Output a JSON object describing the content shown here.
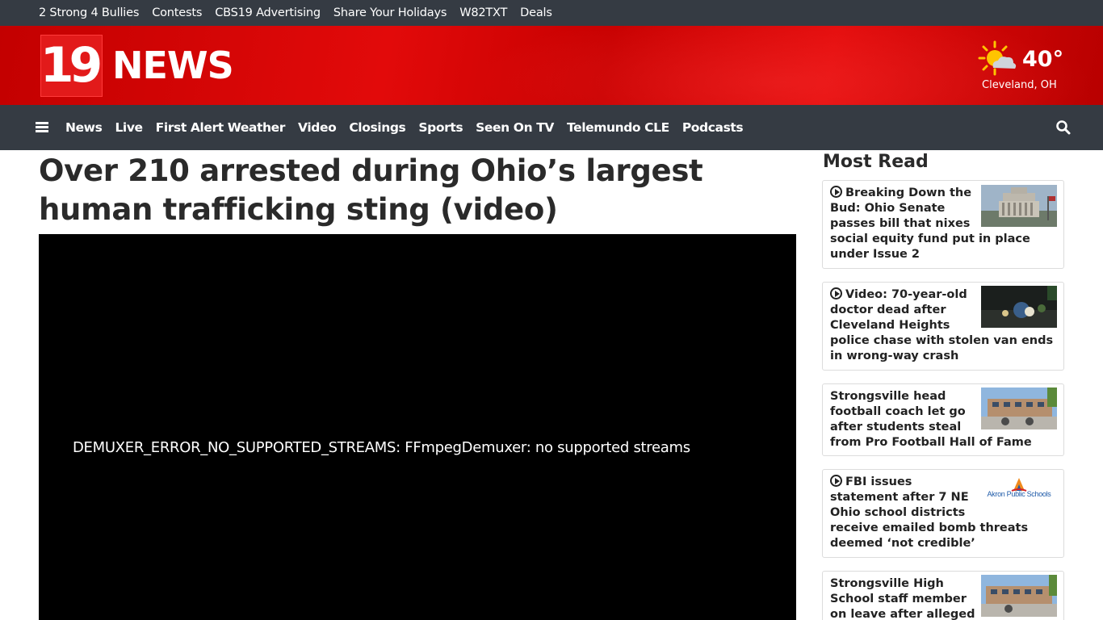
{
  "utility_bar": {
    "links": [
      "2 Strong 4 Bullies",
      "Contests",
      "CBS19 Advertising",
      "Share Your Holidays",
      "W82TXT",
      "Deals"
    ]
  },
  "header": {
    "logo_number": "19",
    "logo_word": "NEWS",
    "weather": {
      "temp": "40°",
      "location": "Cleveland, OH",
      "icon": "partly-sunny-icon"
    },
    "brand_color": "#d60000"
  },
  "nav": {
    "menu_icon": "hamburger-menu-icon",
    "items": [
      "News",
      "Live",
      "First Alert Weather",
      "Video",
      "Closings",
      "Sports",
      "Seen On TV",
      "Telemundo CLE",
      "Podcasts"
    ],
    "search_icon": "search-icon",
    "background": "#353b43"
  },
  "article": {
    "headline": "Over 210 arrested during Ohio’s largest human trafficking sting (video)",
    "video_error": "DEMUXER_ERROR_NO_SUPPORTED_STREAMS: FFmpegDemuxer: no supported streams"
  },
  "sidebar": {
    "title": "Most Read",
    "stories": [
      {
        "title": "Breaking Down the Bud: Ohio Senate passes bill that nixes social equity fund put in place under Issue 2",
        "has_video": true
      },
      {
        "title": "Video: 70-year-old doctor dead after Cleveland Heights police chase with stolen van ends in wrong-way crash",
        "has_video": true
      },
      {
        "title": "Strongsville head football coach let go after students steal from Pro Football Hall of Fame",
        "has_video": false
      },
      {
        "title": "FBI issues statement after 7 NE Ohio school districts receive emailed bomb threats deemed ‘not credible’",
        "has_video": true,
        "thumb_caption": "Akron Public Schools"
      },
      {
        "title": "Strongsville High School staff member on leave after alleged",
        "has_video": false
      }
    ]
  }
}
